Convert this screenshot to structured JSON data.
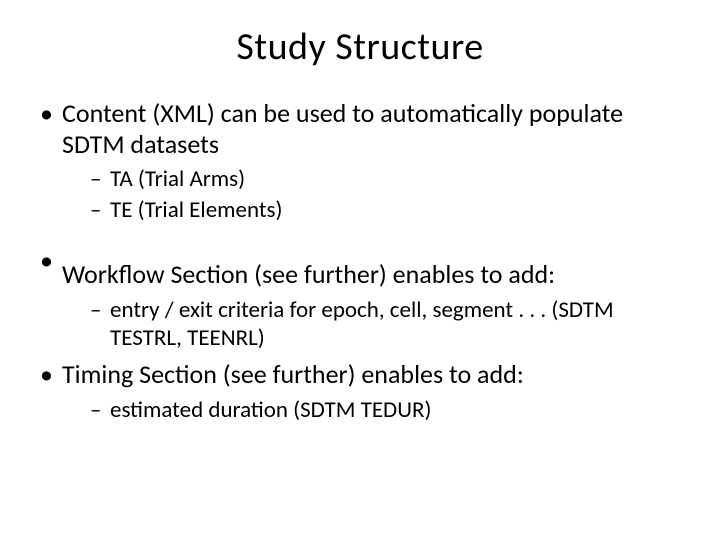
{
  "title": "Study Structure",
  "bullets": {
    "b1": {
      "text": "Content (XML) can be used to automatically populate SDTM datasets",
      "sub1": "TA (Trial Arms)",
      "sub2": "TE (Trial Elements)"
    },
    "b2": {
      "text": "Workflow Section (see further) enables to add:",
      "sub1": "entry / exit criteria for epoch, cell, segment . . . (SDTM TESTRL, TEENRL)"
    },
    "b3": {
      "text": "Timing Section (see further) enables to add:",
      "sub1": "estimated duration (SDTM TEDUR)"
    }
  }
}
